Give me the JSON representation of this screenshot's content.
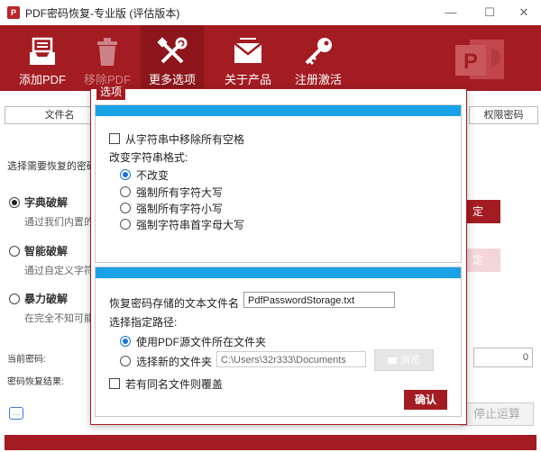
{
  "window": {
    "title": "PDF密码恢复-专业版 (评估版本)",
    "app_icon": "pdf-app-icon",
    "minimize": "—",
    "maximize": "☐",
    "close": "✕"
  },
  "toolbar": {
    "items": [
      {
        "label": "添加PDF",
        "icon": "inbox-tray-icon"
      },
      {
        "label": "移除PDF",
        "icon": "trash-can-icon"
      },
      {
        "label": "更多选项",
        "icon": "tools-icon"
      },
      {
        "label": "关于产品",
        "icon": "envelope-icon"
      },
      {
        "label": "注册激活",
        "icon": "key-icon"
      }
    ],
    "brand_icon": "powerpoint-logo-icon"
  },
  "background": {
    "col_file": "文件名",
    "col_perm": "权限密码",
    "choose_label": "选择需要恢复的密码",
    "dict_label": "字典破解",
    "dict_desc": "通过我们内置的",
    "smart_label": "智能破解",
    "smart_desc": "通过自定义字符",
    "brute_label": "暴力破解",
    "brute_desc": "在完全不知可能",
    "settings_btn": "定",
    "settings_btn2": "定",
    "current_pwd": "当前密码:",
    "result_label": "密码恢复结果:",
    "count_value": "0",
    "stop_btn": "停止运算"
  },
  "dialog": {
    "title": "选项",
    "remove_spaces": "从字符串中移除所有空格",
    "format_label": "改变字符串格式:",
    "format_options": [
      "不改变",
      "强制所有字符大写",
      "强制所有字符小写",
      "强制字符串首字母大写"
    ],
    "format_selected": 0,
    "storage_label": "恢复密码存储的文本文件名",
    "storage_value": "PdfPasswordStorage.txt",
    "path_label": "选择指定路径:",
    "use_source": "使用PDF源文件所在文件夹",
    "choose_new": "选择新的文件夹",
    "folder_value": "C:\\Users\\32r333\\Documents",
    "browse_btn": "浏览",
    "overwrite": "若有同名文件则覆盖",
    "confirm": "确认"
  },
  "colors": {
    "brand_red": "#a31c22",
    "panel_blue": "#1ba1e6",
    "radio_blue": "#1a73d9"
  }
}
